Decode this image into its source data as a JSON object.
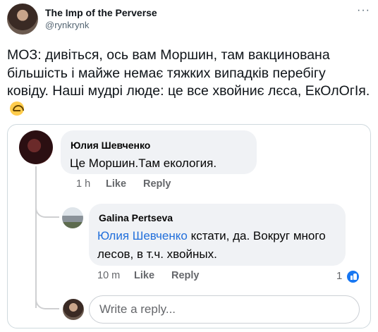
{
  "tweet": {
    "author_name": "The Imp of the Perverse",
    "author_handle": "@rynkrynk",
    "more_icon": "···",
    "text": "МОЗ: дивіться, ось вам Моршин, там вакцинована більшість і майже немає тяжких випадків перебігу ковіду. Наші мудрі люде: це все хвойниє лєса, ЕкОлОгІя.",
    "emoji": "upside-down-face"
  },
  "screenshot": {
    "comment1": {
      "author": "Юлия Шевченко",
      "text": "Це Моршин.Там екология.",
      "time": "1 h",
      "like": "Like",
      "reply": "Reply"
    },
    "comment2": {
      "author": "Galina Pertseva",
      "mention": "Юлия Шевченко",
      "text": " кстати, да. Вокруг много лесов, в т.ч. хвойных.",
      "time": "10 m",
      "like": "Like",
      "reply": "Reply",
      "reactions": "1"
    },
    "reply_placeholder": "Write a reply..."
  },
  "colors": {
    "bubble": "#f0f2f5",
    "mention": "#216fdb",
    "meta": "#65676b",
    "like_blue": "#1877f2"
  }
}
